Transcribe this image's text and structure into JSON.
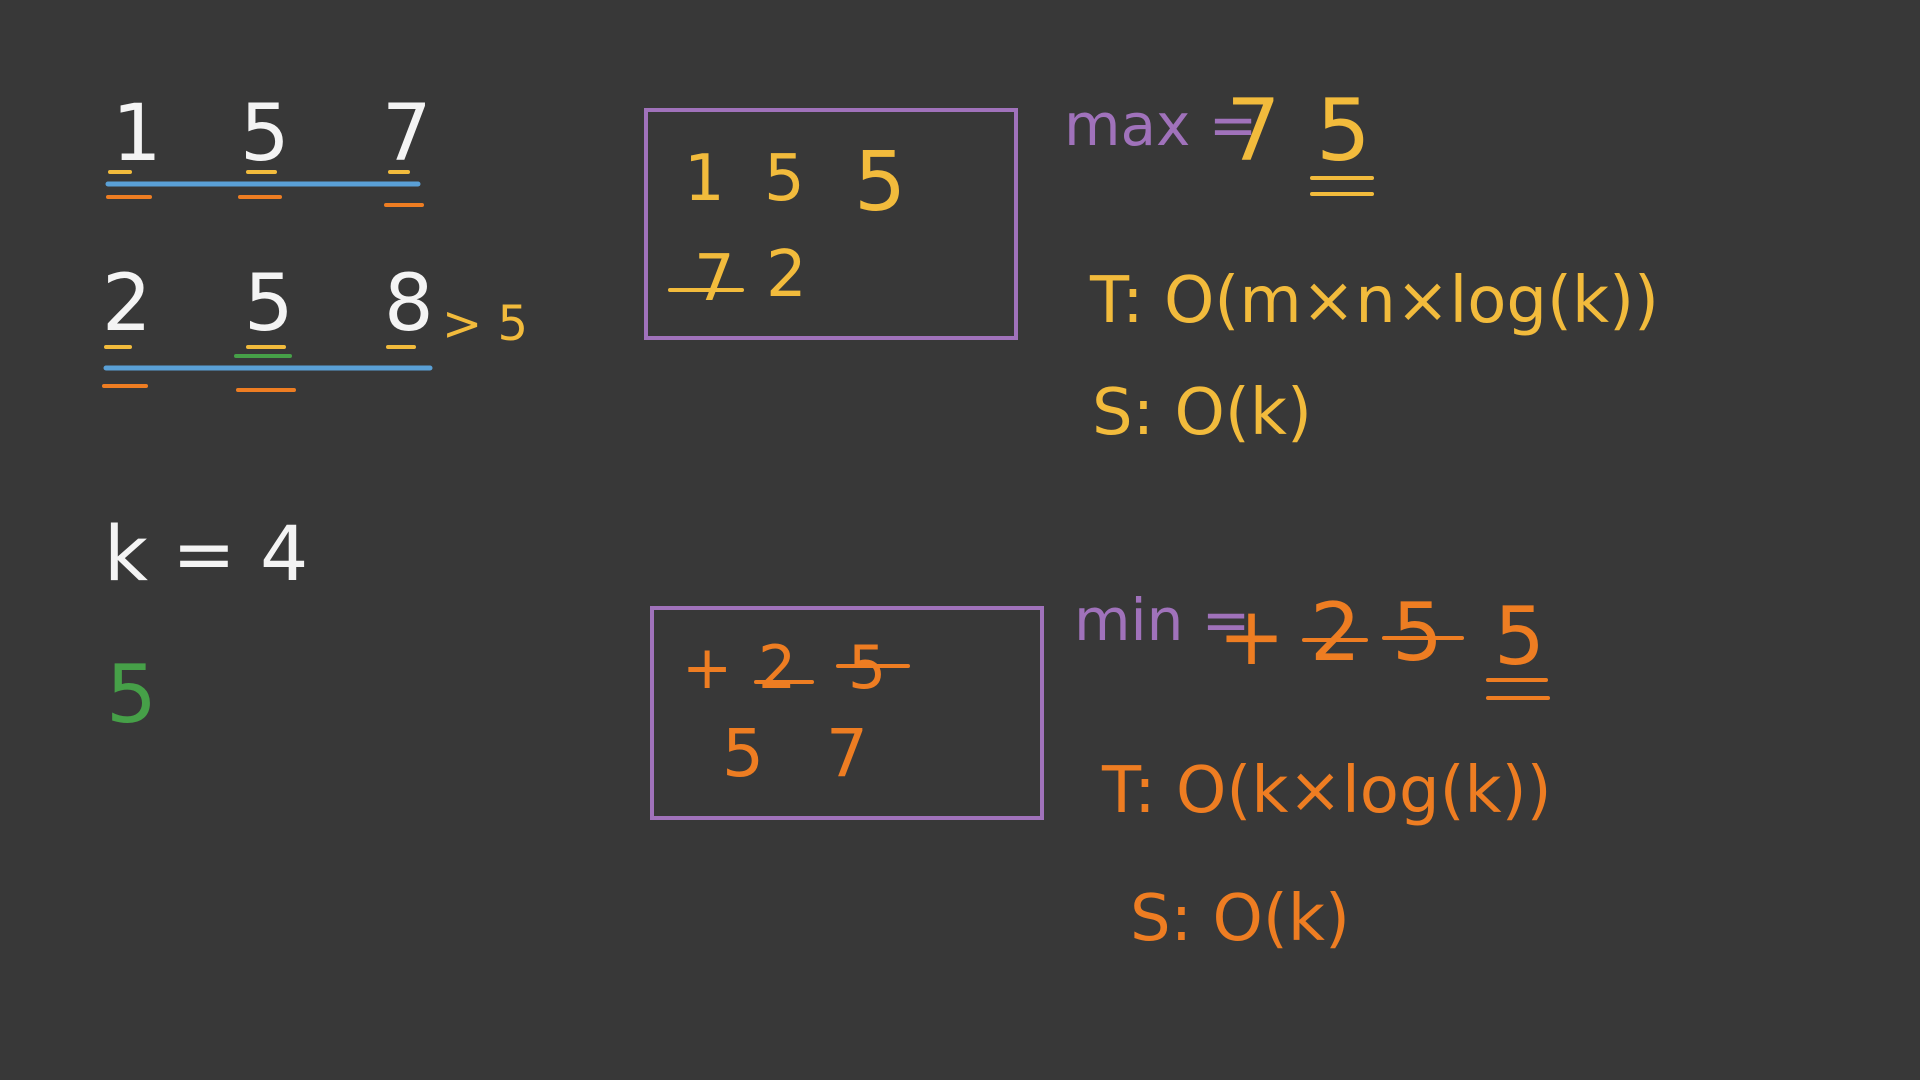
{
  "colors": {
    "background": "#383838",
    "white": "#f4f4f4",
    "blue": "#5aa0d6",
    "orange": "#ee7d22",
    "yellow": "#f2bb3c",
    "purple": "#a072bb",
    "green": "#46a048"
  },
  "left": {
    "row1": [
      "1",
      "5",
      "7"
    ],
    "row2": [
      "2",
      "5",
      "8"
    ],
    "row2_note": "> 5",
    "k_expr": "k = 4",
    "answer": "5"
  },
  "max_heap": {
    "box_row1": [
      "1",
      "5",
      "5"
    ],
    "box_row2_struck": "7",
    "box_row2": "2",
    "label": "max =",
    "values": [
      "7",
      "5"
    ],
    "time": "T: O(m×n×log(k))",
    "space": "S: O(k)"
  },
  "min_heap": {
    "box_row1_struck": [
      "+",
      "2",
      "5"
    ],
    "box_row2": [
      "5",
      "7"
    ],
    "label": "min =",
    "values_struck": [
      "+",
      "2",
      "5"
    ],
    "result": "5",
    "time": "T: O(k×log(k))",
    "space": "S: O(k)"
  }
}
